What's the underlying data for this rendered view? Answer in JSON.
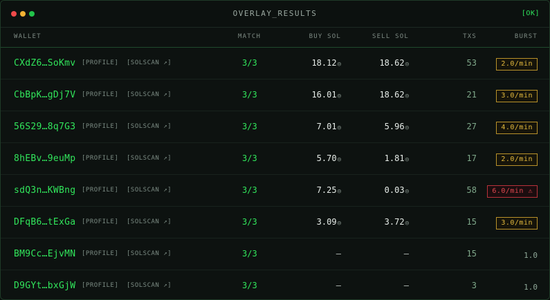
{
  "window": {
    "title": "OVERLAY_RESULTS",
    "status": "[OK]"
  },
  "columns": {
    "wallet": "WALLET",
    "match": "MATCH",
    "buy": "BUY SOL",
    "sell": "SELL SOL",
    "txs": "TXS",
    "burst": "BURST"
  },
  "links": {
    "profile": "[PROFILE]",
    "solscan": "[SOLSCAN ↗]"
  },
  "sol_icon": "◎",
  "rows": [
    {
      "wallet": "CXdZ6…SoKmv",
      "match": "3/3",
      "buy": "18.12",
      "sell": "18.62",
      "txs": "53",
      "burst": "2.0/min",
      "burst_style": "warn"
    },
    {
      "wallet": "CbBpK…gDj7V",
      "match": "3/3",
      "buy": "16.01",
      "sell": "18.62",
      "txs": "21",
      "burst": "3.0/min",
      "burst_style": "warn"
    },
    {
      "wallet": "56S29…8q7G3",
      "match": "3/3",
      "buy": "7.01",
      "sell": "5.96",
      "txs": "27",
      "burst": "4.0/min",
      "burst_style": "warn"
    },
    {
      "wallet": "8hEBv…9euMp",
      "match": "3/3",
      "buy": "5.70",
      "sell": "1.81",
      "txs": "17",
      "burst": "2.0/min",
      "burst_style": "warn"
    },
    {
      "wallet": "sdQ3n…KWBng",
      "match": "3/3",
      "buy": "7.25",
      "sell": "0.03",
      "txs": "58",
      "burst": "6.0/min ⚠",
      "burst_style": "alert"
    },
    {
      "wallet": "DFqB6…tExGa",
      "match": "3/3",
      "buy": "3.09",
      "sell": "3.72",
      "txs": "15",
      "burst": "3.0/min",
      "burst_style": "warn"
    },
    {
      "wallet": "BM9Cc…EjvMN",
      "match": "3/3",
      "buy": "—",
      "sell": "—",
      "txs": "15",
      "burst": "1.0",
      "burst_style": "plain"
    },
    {
      "wallet": "D9GYt…bxGjW",
      "match": "3/3",
      "buy": "—",
      "sell": "—",
      "txs": "3",
      "burst": "1.0",
      "burst_style": "plain"
    }
  ]
}
